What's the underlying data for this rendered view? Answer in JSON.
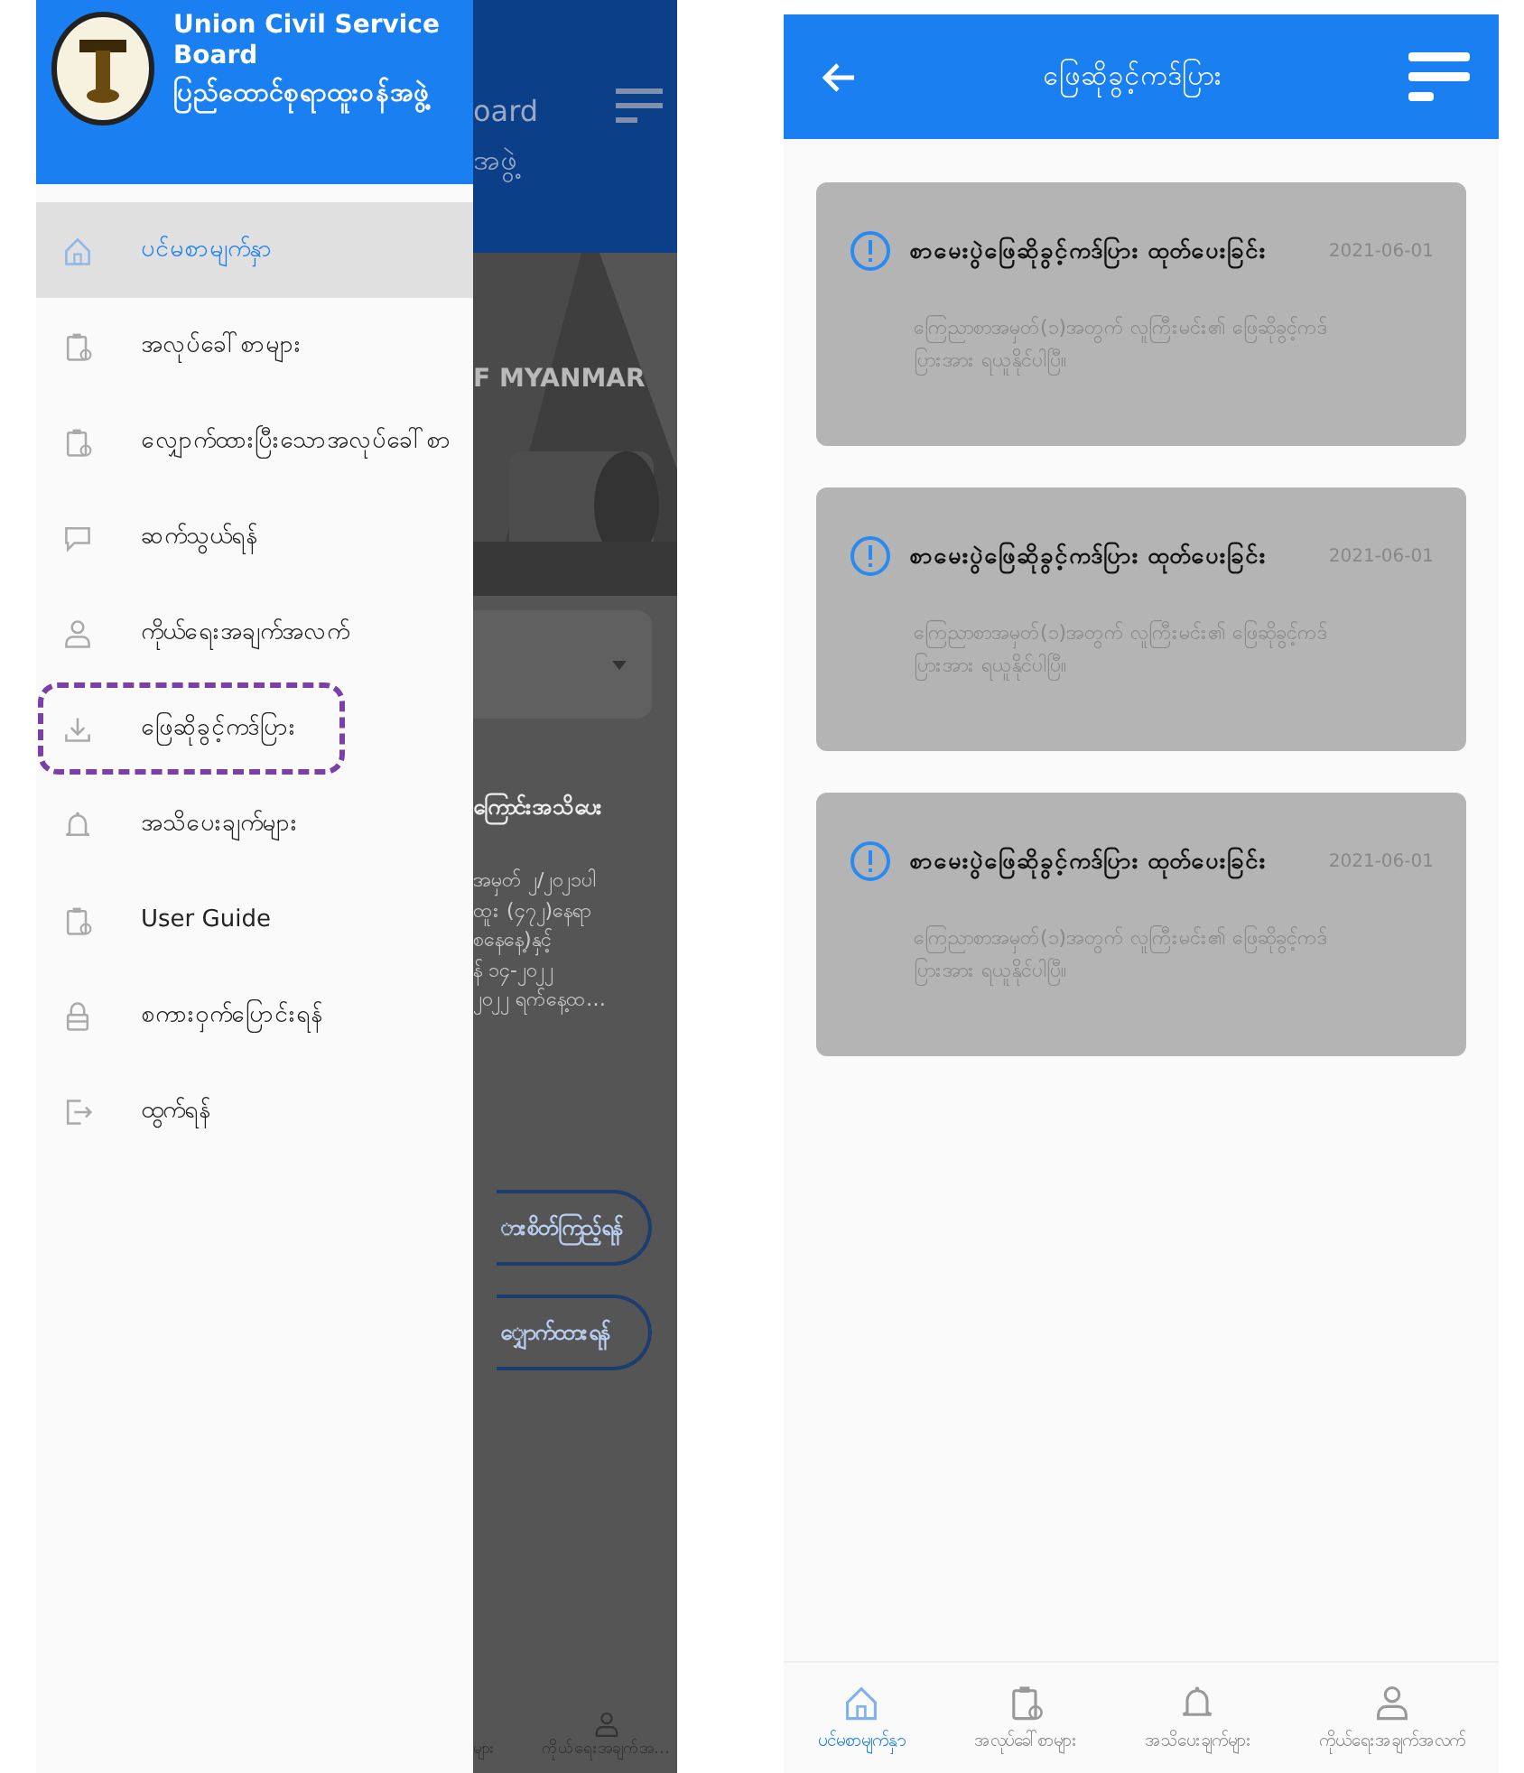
{
  "left_screen": {
    "drawer": {
      "title": "Union Civil Service Board",
      "subtitle": "ပြည်ထောင်စုရာထူးဝန်အဖွဲ့",
      "items": [
        {
          "label": "ပင်မစာမျက်နှာ",
          "kind": "home",
          "selected": true,
          "annotated": false
        },
        {
          "label": "အလုပ်ခေါ်စာများ",
          "kind": "clipboard",
          "selected": false,
          "annotated": false
        },
        {
          "label": "လျှောက်ထားပြီးသောအလုပ်ခေါ်စာ",
          "kind": "clipboard",
          "selected": false,
          "annotated": false
        },
        {
          "label": "ဆက်သွယ်ရန်",
          "kind": "chat",
          "selected": false,
          "annotated": false
        },
        {
          "label": "ကိုယ်ရေးအချက်အလက်",
          "kind": "person",
          "selected": false,
          "annotated": false
        },
        {
          "label": "ဖြေဆိုခွင့်ကဒ်ပြား",
          "kind": "download",
          "selected": false,
          "annotated": true
        },
        {
          "label": "အသိပေးချက်များ",
          "kind": "bell",
          "selected": false,
          "annotated": false
        },
        {
          "label": "User Guide",
          "kind": "clipboard",
          "selected": false,
          "annotated": false
        },
        {
          "label": "စကားဝှက်ပြောင်းရန်",
          "kind": "lock",
          "selected": false,
          "annotated": false
        },
        {
          "label": "ထွက်ရန်",
          "kind": "logout",
          "selected": false,
          "annotated": false
        }
      ]
    },
    "background_app": {
      "header_lines": [
        "oard",
        "အဖွဲ့"
      ],
      "banner_text": "F MYANMAR",
      "section_title": "ကြောင်းအသိပေး",
      "body_lines": [
        "အမှတ် ၂/၂၀၂၁ပါ",
        "ထူး (၄၇၂)နေရာ",
        "စနေနေ့)နှင့်",
        "န် ၁၄-၂၀၂၂",
        "၂၀၂၂ ရက်နေ့ထ…"
      ],
      "buttons": [
        "ားစိတ်ကြည့်ရန်",
        "ျှောက်ထားရန်"
      ],
      "nav_labels": [
        "များ",
        "ကိုယ်ရေးအချက်အ…"
      ]
    }
  },
  "right_screen": {
    "header": {
      "title": "ဖြေဆိုခွင့်ကဒ်ပြား"
    },
    "notifications": [
      {
        "title": "စာမေးပွဲဖြေဆိုခွင့်ကဒ်ပြား ထုတ်ပေးခြင်း",
        "date": "2021-06-01",
        "body": "ကြေညာစာအမှတ်(၁)အတွက် လူကြီးမင်း၏ ဖြေဆိုခွင့်ကဒ်ပြားအား ရယူနိုင်ပါပြီ။"
      },
      {
        "title": "စာမေးပွဲဖြေဆိုခွင့်ကဒ်ပြား ထုတ်ပေးခြင်း",
        "date": "2021-06-01",
        "body": "ကြေညာစာအမှတ်(၁)အတွက် လူကြီးမင်း၏ ဖြေဆိုခွင့်ကဒ်ပြားအား ရယူနိုင်ပါပြီ။"
      },
      {
        "title": "စာမေးပွဲဖြေဆိုခွင့်ကဒ်ပြား ထုတ်ပေးခြင်း",
        "date": "2021-06-01",
        "body": "ကြေညာစာအမှတ်(၁)အတွက် လူကြီးမင်း၏ ဖြေဆိုခွင့်ကဒ်ပြားအား ရယူနိုင်ပါပြီ။"
      }
    ],
    "bottom_nav": [
      {
        "label": "ပင်မစာမျက်နှာ",
        "kind": "home",
        "selected": true
      },
      {
        "label": "အလုပ်ခေါ်စာများ",
        "kind": "clipboard",
        "selected": false
      },
      {
        "label": "အသိပေးချက်များ",
        "kind": "bell",
        "selected": false
      },
      {
        "label": "ကိုယ်ရေးအချက်အလက်",
        "kind": "person",
        "selected": false
      }
    ]
  }
}
